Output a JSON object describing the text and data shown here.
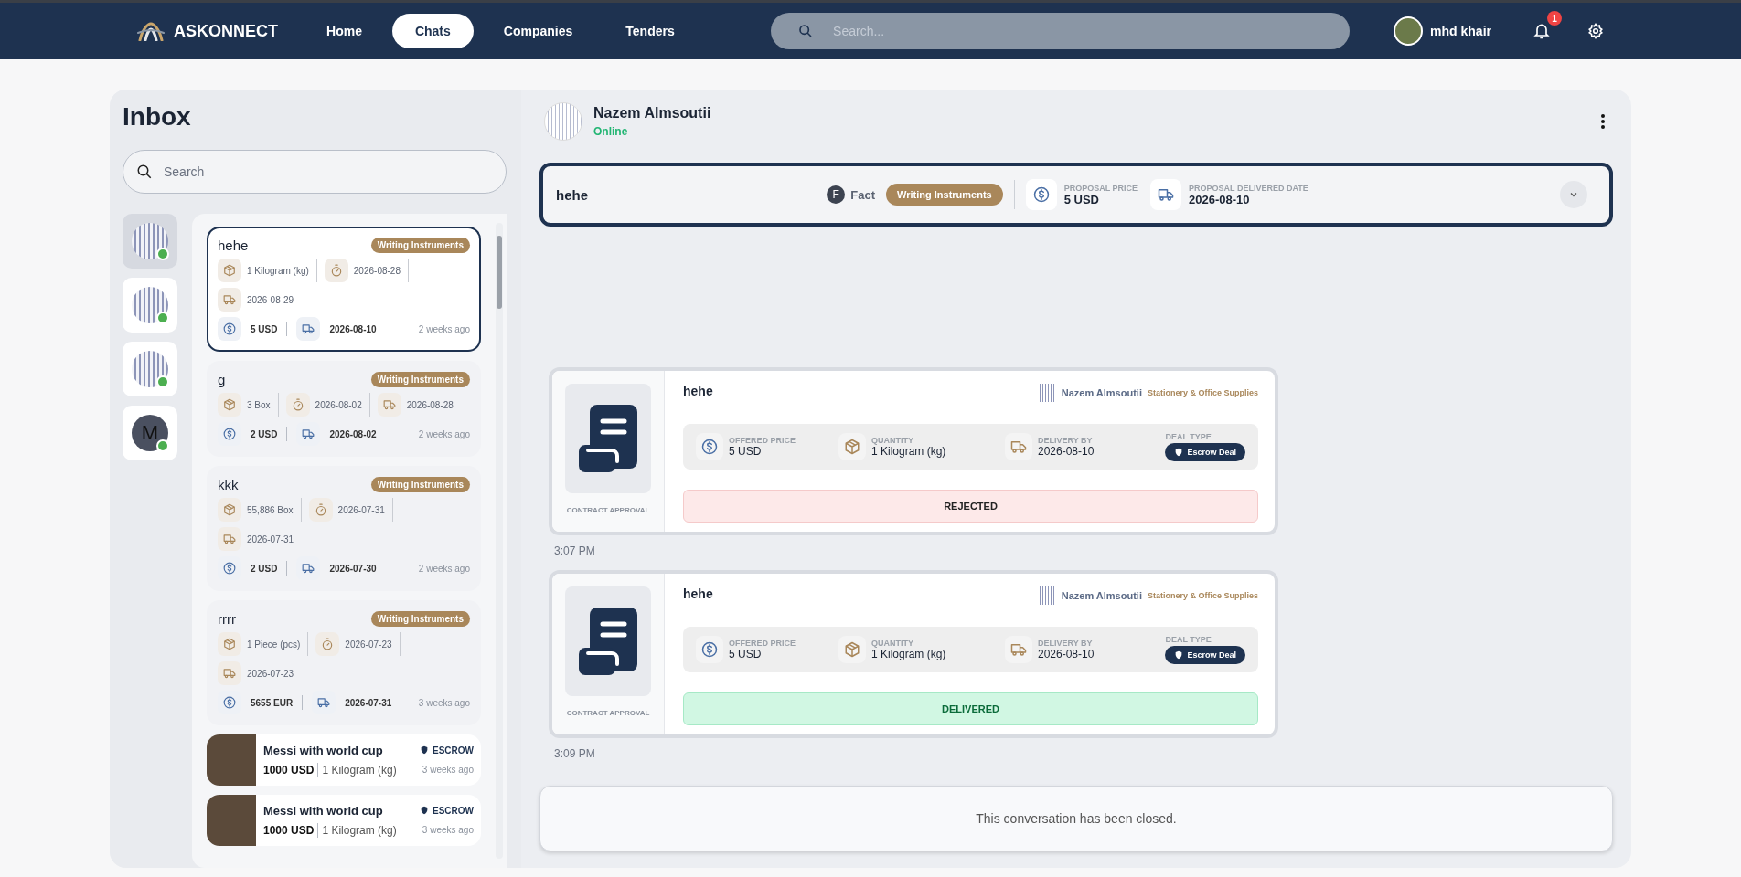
{
  "topbar": {
    "brand": "ASKONNECT",
    "nav": [
      {
        "label": "Home",
        "selected": false
      },
      {
        "label": "Chats",
        "selected": true
      },
      {
        "label": "Companies",
        "selected": false
      },
      {
        "label": "Tenders",
        "selected": false
      }
    ],
    "search": {
      "placeholder": "Search..."
    },
    "user": {
      "name": "mhd khair"
    },
    "notifications": {
      "count": "1"
    }
  },
  "inbox": {
    "title": "Inbox",
    "search": {
      "placeholder": "Search"
    },
    "contacts": [
      {
        "kind": "image",
        "selected": true,
        "online": true
      },
      {
        "kind": "image",
        "selected": false,
        "online": true
      },
      {
        "kind": "image",
        "selected": false,
        "online": true
      },
      {
        "kind": "letter",
        "letter": "M",
        "selected": false,
        "online": true
      }
    ],
    "conversations": [
      {
        "kind": "request",
        "title": "hehe",
        "tag": "Writing Instruments",
        "quantity": "1 Kilogram (kg)",
        "deadline": "2026-08-28",
        "delivery": "2026-08-29",
        "price": "5 USD",
        "proposal_date": "2026-08-10",
        "time": "2 weeks ago",
        "selected": true
      },
      {
        "kind": "request",
        "title": "g",
        "tag": "Writing Instruments",
        "quantity": "3 Box",
        "deadline": "2026-08-02",
        "delivery": "2026-08-28",
        "price": "2 USD",
        "proposal_date": "2026-08-02",
        "time": "2 weeks ago",
        "selected": false
      },
      {
        "kind": "request",
        "title": "kkk",
        "tag": "Writing Instruments",
        "quantity": "55,886 Box",
        "deadline": "2026-07-31",
        "delivery": "2026-07-31",
        "price": "2 USD",
        "proposal_date": "2026-07-30",
        "time": "2 weeks ago",
        "selected": false
      },
      {
        "kind": "request",
        "title": "rrrr",
        "tag": "Writing Instruments",
        "quantity": "1 Piece (pcs)",
        "deadline": "2026-07-23",
        "delivery": "2026-07-23",
        "price": "5655 EUR",
        "proposal_date": "2026-07-31",
        "time": "3 weeks ago",
        "selected": false
      },
      {
        "kind": "product",
        "title": "Messi with world cup",
        "badge": "ESCROW",
        "price": "1000 USD",
        "quantity": "1 Kilogram (kg)",
        "time": "3 weeks ago",
        "selected": false
      },
      {
        "kind": "product",
        "title": "Messi with world cup",
        "badge": "ESCROW",
        "price": "1000 USD",
        "quantity": "1 Kilogram (kg)",
        "time": "3 weeks ago",
        "selected": false
      }
    ]
  },
  "chat": {
    "contact": {
      "name": "Nazem Almsoutii",
      "status": "Online"
    },
    "proposal": {
      "title": "hehe",
      "company_initial": "F",
      "company": "Fact",
      "tag": "Writing Instruments",
      "price_label": "PROPOSAL PRICE",
      "price": "5 USD",
      "date_label": "PROPOSAL DELIVERED DATE",
      "date": "2026-08-10"
    },
    "messages": [
      {
        "caption": "CONTRACT APPROVAL",
        "title": "hehe",
        "sender": "Nazem Almsoutii",
        "category": "Stationery & Office Supplies",
        "fields": [
          {
            "kind": "price",
            "label": "OFFERED PRICE",
            "value": "5 USD"
          },
          {
            "kind": "quantity",
            "label": "QUANTITY",
            "value": "1 Kilogram (kg)"
          },
          {
            "kind": "delivery",
            "label": "DELIVERY BY",
            "value": "2026-08-10"
          }
        ],
        "deal_type_label": "DEAL TYPE",
        "deal_type": "Escrow Deal",
        "status": {
          "kind": "rejected",
          "text": "REJECTED"
        },
        "time": "3:07 PM"
      },
      {
        "caption": "CONTRACT APPROVAL",
        "title": "hehe",
        "sender": "Nazem Almsoutii",
        "category": "Stationery & Office Supplies",
        "fields": [
          {
            "kind": "price",
            "label": "OFFERED PRICE",
            "value": "5 USD"
          },
          {
            "kind": "quantity",
            "label": "QUANTITY",
            "value": "1 Kilogram (kg)"
          },
          {
            "kind": "delivery",
            "label": "DELIVERY BY",
            "value": "2026-08-10"
          }
        ],
        "deal_type_label": "DEAL TYPE",
        "deal_type": "Escrow Deal",
        "status": {
          "kind": "delivered",
          "text": "DELIVERED"
        },
        "time": "3:09 PM"
      }
    ],
    "closed_notice": "This conversation has been closed."
  }
}
